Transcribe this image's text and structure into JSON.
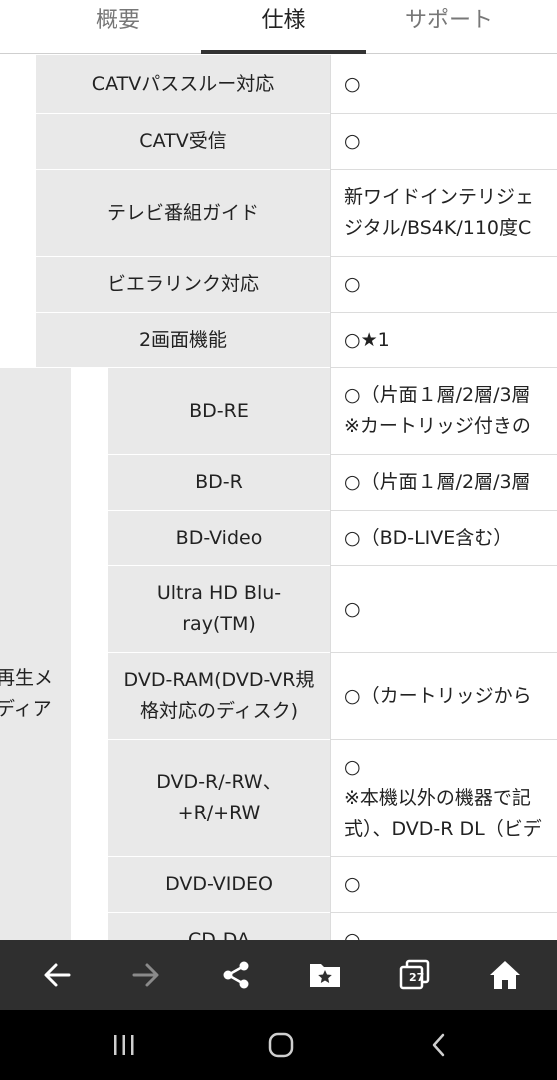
{
  "tabs": [
    {
      "label": "概要",
      "active": false
    },
    {
      "label": "仕様",
      "active": true
    },
    {
      "label": "サポート",
      "active": false
    }
  ],
  "spec_rows": [
    {
      "label": "CATVパススルー対応",
      "value": "○"
    },
    {
      "label": "CATV受信",
      "value": "○"
    },
    {
      "label": "テレビ番組ガイド",
      "value": "新ワイドインテリジェ\nジタル/BS4K/110度C"
    },
    {
      "label": "ビエラリンク対応",
      "value": "○"
    },
    {
      "label": "2画面機能",
      "value": "○★1"
    }
  ],
  "playback_media": {
    "group_label": "再生メ\nディア",
    "rows": [
      {
        "label": "BD-RE",
        "value": "○（片面１層/2層/3層\n※カートリッジ付きの"
      },
      {
        "label": "BD-R",
        "value": "○（片面１層/2層/3層"
      },
      {
        "label": "BD-Video",
        "value": "○（BD-LIVE含む）"
      },
      {
        "label": "Ultra HD Blu-\nray(TM)",
        "value": "○"
      },
      {
        "label": "DVD-RAM(DVD-VR規\n格対応のディスク)",
        "value": "○（カートリッジから"
      },
      {
        "label": "DVD-R/-RW、\n+R/+RW",
        "value": "○\n※本機以外の機器で記\n式）、DVD-R DL（ビデ"
      },
      {
        "label": "DVD-VIDEO",
        "value": "○"
      },
      {
        "label": "CD-DA",
        "value": "○"
      }
    ]
  },
  "browser_toolbar": {
    "buttons": [
      "back-icon",
      "forward-icon",
      "share-icon",
      "bookmarks-icon",
      "tabs-icon",
      "home-icon"
    ],
    "tab_count": "27",
    "icon_color": "#ffffff",
    "disabled_color": "#8a8a8a"
  },
  "system_nav": {
    "buttons": [
      "recent-apps-icon",
      "home-nav-icon",
      "back-nav-icon"
    ]
  }
}
